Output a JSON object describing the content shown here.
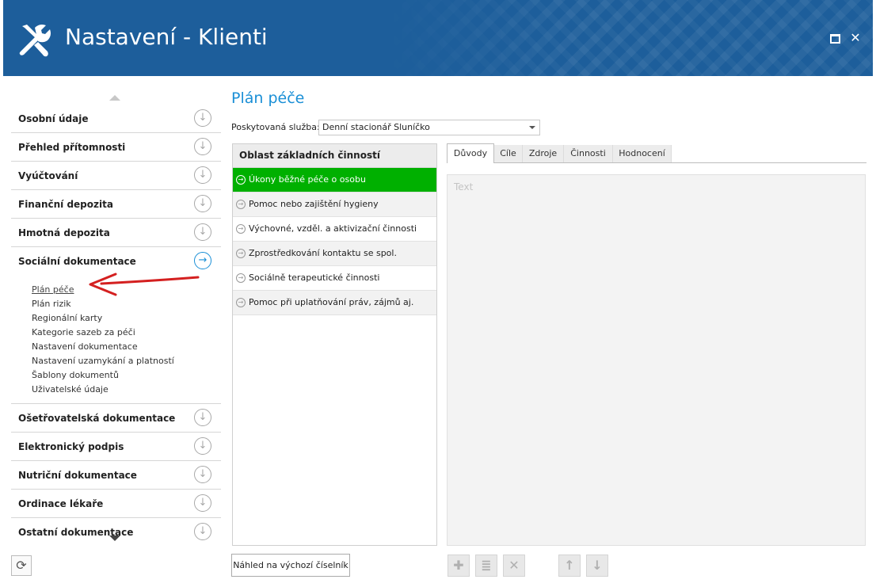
{
  "window": {
    "title": "Nastavení - Klienti"
  },
  "sidebar": {
    "sections_top": [
      {
        "label": "Osobní údaje"
      },
      {
        "label": "Přehled přítomnosti"
      },
      {
        "label": "Vyúčtování"
      },
      {
        "label": "Finanční depozita"
      },
      {
        "label": "Hmotná depozita"
      },
      {
        "label": "Sociální dokumentace",
        "active": true
      }
    ],
    "subitems": [
      {
        "label": "Plán péče",
        "current": true
      },
      {
        "label": "Plán rizik"
      },
      {
        "label": "Regionální karty"
      },
      {
        "label": "Kategorie sazeb za péči"
      },
      {
        "label": "Nastavení dokumentace"
      },
      {
        "label": "Nastavení uzamykání a platností"
      },
      {
        "label": "Šablony dokumentů"
      },
      {
        "label": "Uživatelské údaje"
      }
    ],
    "sections_bottom": [
      {
        "label": "Ošetřovatelská dokumentace"
      },
      {
        "label": "Elektronický podpis"
      },
      {
        "label": "Nutriční dokumentace"
      },
      {
        "label": "Ordinace lékaře"
      },
      {
        "label": "Ostatní dokumentace"
      }
    ]
  },
  "main": {
    "title": "Plán péče",
    "service_label": "Poskytovaná služba:",
    "service_value": "Denní stacionář Sluníčko",
    "areas_header": "Oblast základních činností",
    "areas": [
      {
        "label": "Úkony běžné péče o osobu",
        "selected": true
      },
      {
        "label": "Pomoc nebo zajištění hygieny"
      },
      {
        "label": "Výchovné, vzděl. a aktivizační činnosti"
      },
      {
        "label": "Zprostředkování kontaktu se spol."
      },
      {
        "label": "Sociálně terapeutické činnosti"
      },
      {
        "label": "Pomoc při uplatňování práv, zájmů aj."
      }
    ],
    "tabs": [
      {
        "label": "Důvody",
        "active": true
      },
      {
        "label": "Cíle"
      },
      {
        "label": "Zdroje"
      },
      {
        "label": "Činnosti"
      },
      {
        "label": "Hodnocení"
      }
    ],
    "text_placeholder": "Text",
    "default_button": "Náhled na výchozí číselník"
  },
  "icons": {
    "title": "wrench-screwdriver-icon",
    "section_collapsed": "circle-arrow-down-icon",
    "section_expanded": "circle-arrow-right-icon",
    "area_row": "circle-arrow-right-icon",
    "toolbar": [
      "plus-icon",
      "edit-icon",
      "delete-icon",
      "arrow-up-icon",
      "arrow-down-icon"
    ]
  },
  "colors": {
    "titlebar": "#1d5e9b",
    "accent": "#1a8fd6",
    "selected_row": "#00b000"
  }
}
